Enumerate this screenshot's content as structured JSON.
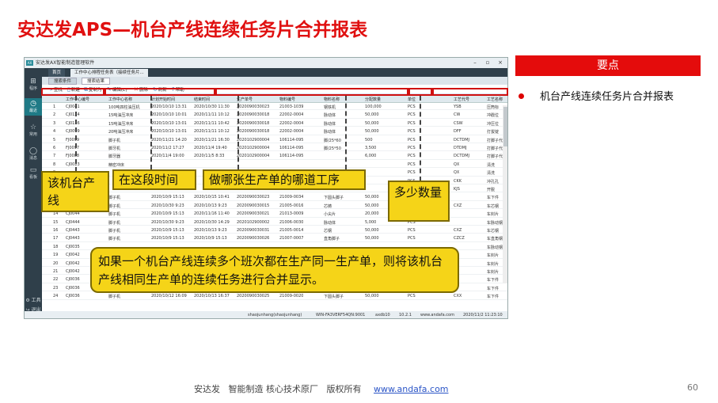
{
  "slide": {
    "title": "安达发APS—机台产线连续任务片合并报表",
    "right_header": "要点",
    "bullet": "机台产线连续任务片合并报表",
    "footer_company": "安达发",
    "footer_slogan": "智能制造 核心技术原厂",
    "footer_rights": "版权所有",
    "footer_url": "www.andafa.com",
    "page_number": "60"
  },
  "app": {
    "window_title": "安达发AX智能制造管理软件",
    "logo_text": "AX",
    "tabs": [
      "首页",
      "工作中心排程任务表（接续任务片..."
    ],
    "subtabs": [
      "搜索条件",
      "搜索结果"
    ],
    "toolbar": [
      {
        "icon": "search-icon",
        "label": "查找"
      },
      {
        "icon": "new-icon",
        "label": "新建"
      },
      {
        "icon": "copy-icon",
        "label": "复制为"
      },
      {
        "icon": "edit-icon",
        "label": "编辑(E)"
      },
      {
        "icon": "delete-icon",
        "label": "删除"
      },
      {
        "icon": "refresh-icon",
        "label": "刷新"
      },
      {
        "icon": "help-icon",
        "label": "帮助"
      }
    ],
    "sidebar": [
      {
        "icon": "grid-icon",
        "label": "程序"
      },
      {
        "icon": "clock-icon",
        "label": "最近"
      },
      {
        "icon": "star-icon",
        "label": "常用"
      },
      {
        "icon": "message-icon",
        "label": "消息"
      },
      {
        "icon": "dashboard-icon",
        "label": "看板"
      },
      {
        "icon": "tools-icon",
        "label": "工具"
      },
      {
        "icon": "exit-icon",
        "label": "退出"
      }
    ],
    "columns": [
      "工作中心编号",
      "工作中心名称",
      "计划开始时间",
      "结束时间",
      "生产单号",
      "物料编号",
      "物料名称",
      "分配数量",
      "单位",
      "工艺代号",
      "工艺名称"
    ],
    "rows": [
      [
        "1",
        "CJ0041",
        "100吨四柱油压机",
        "2020/10/10 13:31",
        "2020/10/30 11:30",
        "2020090030023",
        "21003-1039",
        "钢铁机",
        "100,000",
        "PCS",
        "YSB",
        "压筒标"
      ],
      [
        "2",
        "CJ0124",
        "15吨油压冲床",
        "2020/10/10 10:01",
        "2020/11/11 10:12",
        "2020090030018",
        "22002-0004",
        "脉动体",
        "50,000",
        "PCS",
        "CW",
        "冲戳位"
      ],
      [
        "3",
        "CJ0126",
        "15吨油压冲床",
        "2020/10/10 13:01",
        "2020/11/11 10:42",
        "2020090030018",
        "22002-0004",
        "脉动体",
        "50,000",
        "PCS",
        "CSW",
        "冲压位"
      ],
      [
        "4",
        "CJ0099",
        "20吨油压冲床",
        "2020/10/10 13:01",
        "2020/11/11 10:12",
        "2020090030018",
        "22002-0004",
        "脉动体",
        "50,000",
        "PCS",
        "DFF",
        "打拔锭"
      ],
      [
        "5",
        "FJ0099",
        "脚子机",
        "2020/11/21 14:20",
        "2020/11/21 16:30",
        "2020102900004",
        "106114-095",
        "脚/25*60",
        "500",
        "PCS",
        "DCTDMJ",
        "打脚子代号锁"
      ],
      [
        "6",
        "FJ0097",
        "脚牙机",
        "2020/11/2 17:27",
        "2020/11/4 19:40",
        "2020102900004",
        "106114-095",
        "脚/25*50",
        "3,500",
        "PCS",
        "DTDMJ",
        "打脚子代号锁"
      ],
      [
        "7",
        "FJ0088",
        "脚牙器",
        "2020/11/4 19:00",
        "2020/11/5 8:33",
        "2020102900004",
        "106114-095",
        "",
        "6,000",
        "PCS",
        "DCTDMJ",
        "打脚子代号锁"
      ],
      [
        "8",
        "CJ0023",
        "精密冲床",
        "",
        "",
        "",
        "",
        "",
        "",
        "PCS",
        "QX",
        "清洗"
      ],
      [
        "9",
        "",
        "",
        "",
        "",
        "",
        "",
        "",
        "",
        "PCS",
        "QX",
        "清洗"
      ],
      [
        "10",
        "",
        "",
        "",
        "",
        "",
        "",
        "",
        "",
        "PCS",
        "CKK",
        "冲孔孔"
      ],
      [
        "11",
        "",
        "",
        "",
        "",
        "",
        "",
        "",
        "",
        "PCS",
        "KJS",
        "开脱"
      ],
      [
        "12",
        "CJ0039",
        "脚子机",
        "2020/10/9 15:13",
        "2020/10/15 10:41",
        "2020090030023",
        "21009-0034",
        "下圆头脚子",
        "50,000",
        "PCS",
        "",
        "车下件"
      ],
      [
        "13",
        "CJ0041",
        "脚子机",
        "2020/10/30 9:23",
        "2020/10/13 9:23",
        "2020090030015",
        "21005-0016",
        "芯铸",
        "50,000",
        "PCS",
        "CXZ",
        "车芯钢"
      ],
      [
        "14",
        "CJ0044",
        "脚子机",
        "2020/10/9 15:13",
        "2020/11/16 11:40",
        "2020090030021",
        "21013-0009",
        "小尖片",
        "20,000",
        "PCS",
        "",
        "车封片"
      ],
      [
        "15",
        "CJ0444",
        "脚子机",
        "2020/10/30 9:23",
        "2020/10/30 14:29",
        "2020102900002",
        "21006-0030",
        "脉动体",
        "5,000",
        "PCS",
        "",
        "车脉动钢"
      ],
      [
        "16",
        "CJ0443",
        "脚子机",
        "2020/10/9 15:13",
        "2020/10/13 9:23",
        "2020090030031",
        "21005-0014",
        "芯钢",
        "50,000",
        "PCS",
        "CXZ",
        "车芯钢"
      ],
      [
        "17",
        "CJ0443",
        "脚子机",
        "2020/10/9 15:13",
        "2020/10/9 15:13",
        "2020090030026",
        "21007-0007",
        "直角脚子",
        "50,000",
        "PCS",
        "CZCZ",
        "车直角钢"
      ],
      [
        "18",
        "CJ0035",
        "",
        "",
        "",
        "",
        "",
        "",
        "",
        "",
        "",
        "车脉动钢"
      ],
      [
        "19",
        "CJ0042",
        "",
        "",
        "",
        "",
        "",
        "",
        "",
        "",
        "",
        "车封片"
      ],
      [
        "20",
        "CJ0042",
        "",
        "",
        "",
        "",
        "",
        "",
        "",
        "",
        "",
        "车封片"
      ],
      [
        "21",
        "CJ0042",
        "",
        "",
        "",
        "",
        "",
        "",
        "",
        "",
        "",
        "车封片"
      ],
      [
        "22",
        "CJ0036",
        "",
        "",
        "",
        "",
        "",
        "",
        "",
        "",
        "",
        "车下件"
      ],
      [
        "23",
        "CJ0036",
        "",
        "",
        "",
        "",
        "",
        "",
        "",
        "",
        "",
        "车下件"
      ],
      [
        "24",
        "CJ0036",
        "脚子机",
        "2020/10/12 16:09",
        "2020/10/13 16:37",
        "2020090030025",
        "21009-0020",
        "下圆头脚子",
        "50,000",
        "PCS",
        "CXX",
        "车下件"
      ]
    ],
    "statusbar": {
      "user": "shaojunhang(shaojunhang)",
      "host": "WIN-FA3VERF54QN:9001",
      "db": "axdb10",
      "ip": "10.2.1",
      "url": "www.andafa.com",
      "datetime": "2020/11/2 11:23:10"
    }
  },
  "callouts": {
    "machine": "该机台产线",
    "period": "在这段时间",
    "order_process": "做哪张生产单的哪道工序",
    "quantity": "多少数量",
    "note": "如果一个机台产线连续多个班次都在生产同一生产单，则将该机台产线相同生产单的连续任务进行合并显示。"
  }
}
